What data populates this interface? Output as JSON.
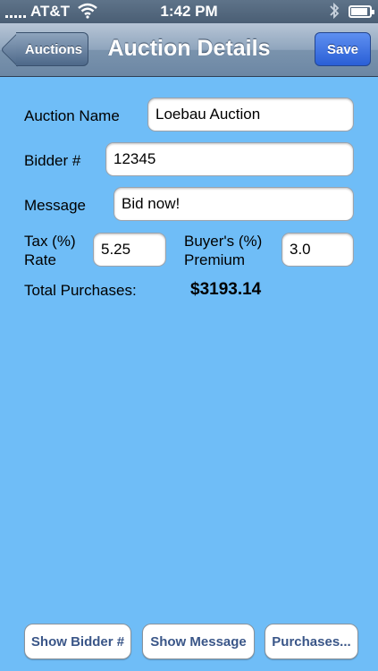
{
  "status_bar": {
    "carrier": "AT&T",
    "time": "1:42 PM",
    "wifi_icon": "wifi-icon",
    "bluetooth_icon": "bluetooth-icon",
    "battery_icon": "battery-charging-icon"
  },
  "nav": {
    "title": "Auction Details",
    "back_label": "Auctions",
    "save_label": "Save"
  },
  "form": {
    "auction_name_label": "Auction Name",
    "auction_name_value": "Loebau Auction",
    "bidder_label": "Bidder #",
    "bidder_value": "12345",
    "message_label": "Message",
    "message_value": "Bid now!",
    "tax_label_line1": "Tax (%)",
    "tax_label_line2": "Rate",
    "tax_value": "5.25",
    "premium_label_line1": "Buyer's (%)",
    "premium_label_line2": "Premium",
    "premium_value": "3.0",
    "total_label": "Total Purchases:",
    "total_value": "$3193.14"
  },
  "bottom_buttons": {
    "show_bidder": "Show Bidder #",
    "show_message": "Show Message",
    "purchases": "Purchases..."
  },
  "colors": {
    "background": "#6fbdf7",
    "nav_bar": "#7a93ad",
    "save_button": "#2a5fd6",
    "button_text": "#3a5688"
  }
}
